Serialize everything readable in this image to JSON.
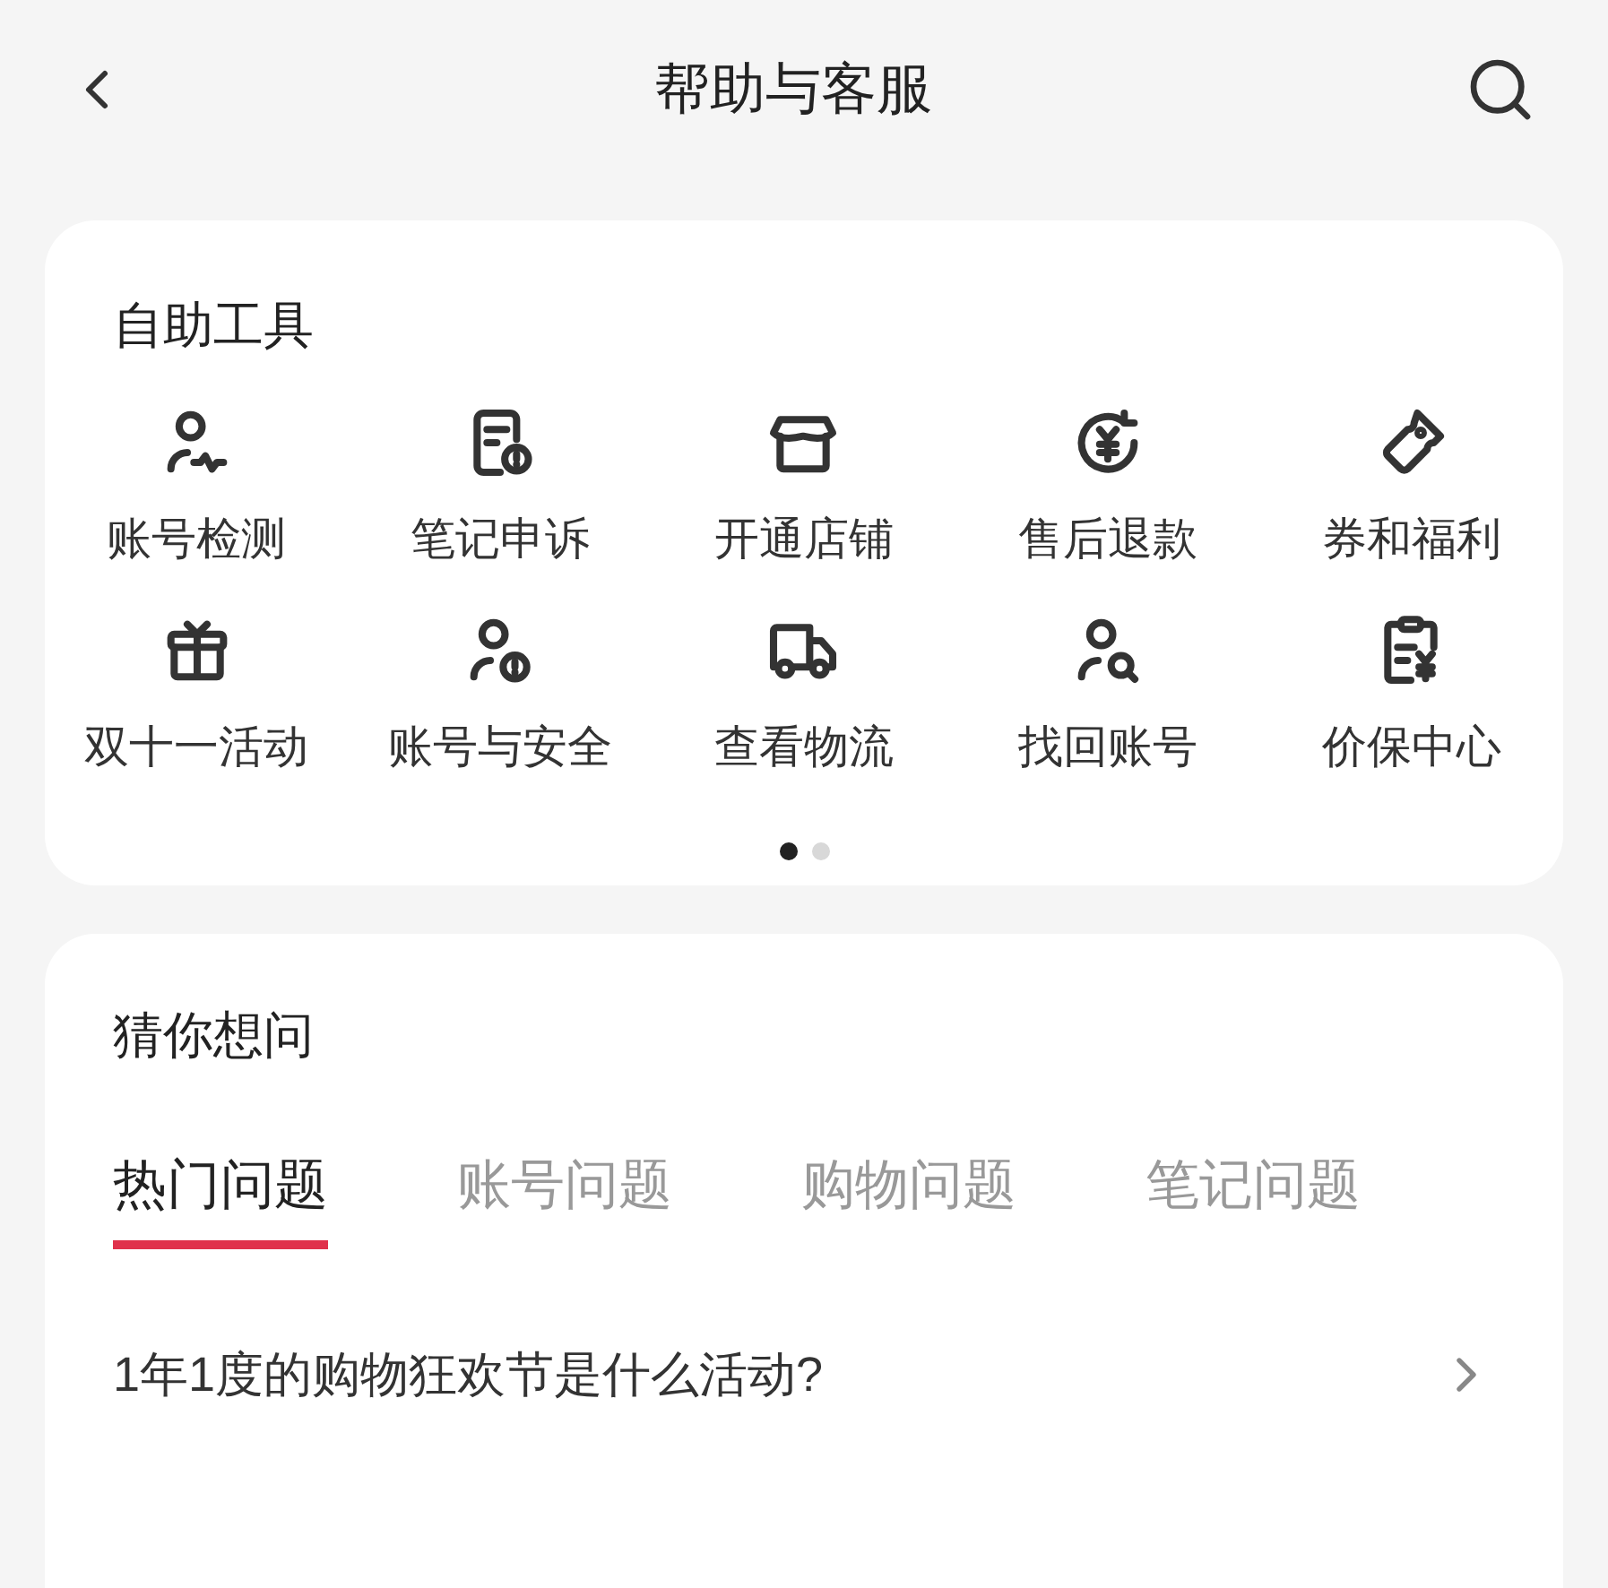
{
  "header": {
    "title": "帮助与客服"
  },
  "tools": {
    "title": "自助工具",
    "items": [
      {
        "label": "账号检测",
        "kind": "user-pulse"
      },
      {
        "label": "笔记申诉",
        "kind": "note-alert"
      },
      {
        "label": "开通店铺",
        "kind": "store"
      },
      {
        "label": "售后退款",
        "kind": "yen-refresh"
      },
      {
        "label": "券和福利",
        "kind": "ticket"
      },
      {
        "label": "双十一活动",
        "kind": "gift"
      },
      {
        "label": "账号与安全",
        "kind": "user-alert"
      },
      {
        "label": "查看物流",
        "kind": "truck"
      },
      {
        "label": "找回账号",
        "kind": "user-search"
      },
      {
        "label": "价保中心",
        "kind": "clipboard-yen"
      }
    ],
    "pages": [
      {
        "selected": true
      },
      {
        "selected": false
      }
    ]
  },
  "faq": {
    "title": "猜你想问",
    "tabs": [
      {
        "label": "热门问题",
        "selected": true
      },
      {
        "label": "账号问题",
        "selected": false
      },
      {
        "label": "购物问题",
        "selected": false
      },
      {
        "label": "笔记问题",
        "selected": false
      }
    ],
    "questions": [
      "1年1度的购物狂欢节是什么活动?"
    ]
  }
}
